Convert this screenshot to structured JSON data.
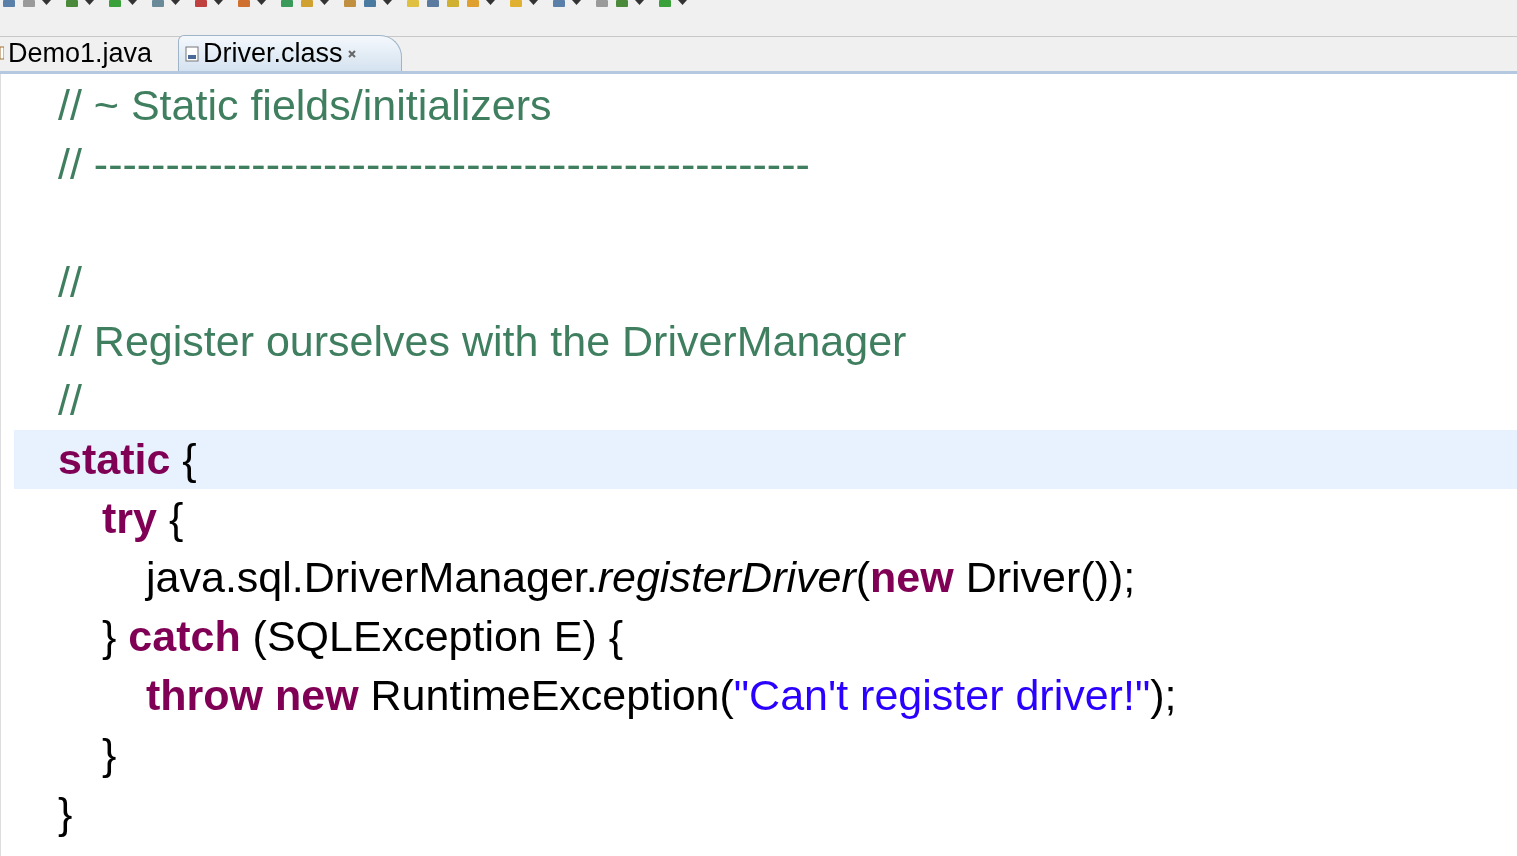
{
  "tabs": [
    {
      "label": "Demo1.java",
      "selected": false,
      "kind": "java"
    },
    {
      "label": "Driver.class",
      "selected": true,
      "kind": "class"
    }
  ],
  "editor": {
    "lines": [
      {
        "current": false,
        "tokens": [
          {
            "kind": "comment",
            "text": "// ~ Static fields/initializers"
          }
        ]
      },
      {
        "current": false,
        "tokens": [
          {
            "kind": "comment",
            "text": "// --------------------------------------------------"
          }
        ]
      },
      {
        "current": false
      },
      {
        "current": false,
        "tokens": [
          {
            "kind": "comment",
            "text": "//"
          }
        ]
      },
      {
        "current": false,
        "tokens": [
          {
            "kind": "comment",
            "text": "// Register ourselves with the DriverManager"
          }
        ]
      },
      {
        "current": false,
        "tokens": [
          {
            "kind": "comment",
            "text": "//"
          }
        ]
      },
      {
        "current": true,
        "tokens": [
          {
            "kind": "keyword",
            "text": "static"
          },
          {
            "kind": "plain",
            "text": " {"
          }
        ],
        "children": [
          {
            "current": false,
            "tokens": [
              {
                "kind": "keyword",
                "text": "try"
              },
              {
                "kind": "plain",
                "text": " {"
              }
            ],
            "children": [
              {
                "current": false,
                "tokens": [
                  {
                    "kind": "plain",
                    "text": "java.sql.DriverManager."
                  },
                  {
                    "kind": "method",
                    "text": "registerDriver"
                  },
                  {
                    "kind": "plain",
                    "text": "("
                  },
                  {
                    "kind": "keyword",
                    "text": "new"
                  },
                  {
                    "kind": "plain",
                    "text": " Driver());"
                  }
                ]
              }
            ]
          },
          {
            "current": false,
            "tokens": [
              {
                "kind": "plain",
                "text": "} "
              },
              {
                "kind": "keyword",
                "text": "catch"
              },
              {
                "kind": "plain",
                "text": " (SQLException E) {"
              }
            ],
            "children": [
              {
                "current": false,
                "tokens": [
                  {
                    "kind": "keyword",
                    "text": "throw new"
                  },
                  {
                    "kind": "plain",
                    "text": " RuntimeException("
                  },
                  {
                    "kind": "string",
                    "text": "\"Can't register driver!\""
                  },
                  {
                    "kind": "plain",
                    "text": ");"
                  }
                ]
              }
            ]
          },
          {
            "current": false,
            "tokens": [
              {
                "kind": "plain",
                "text": "}"
              }
            ]
          }
        ]
      },
      {
        "current": false,
        "tokens": [
          {
            "kind": "plain",
            "text": "}"
          }
        ]
      }
    ]
  }
}
